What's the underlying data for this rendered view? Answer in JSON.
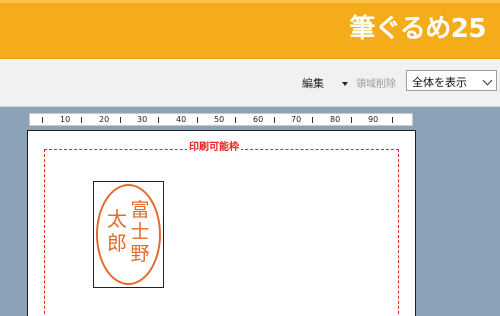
{
  "app": {
    "logo_text": "筆ぐるめ25"
  },
  "toolbar": {
    "edit_label": "編集",
    "delete_label": "領域削除",
    "view_select": {
      "value": "全体を表示"
    }
  },
  "ruler": {
    "labels": [
      "10",
      "20",
      "30",
      "40",
      "50",
      "60",
      "70",
      "80",
      "90"
    ]
  },
  "canvas": {
    "printable_label": "印刷可能枠"
  },
  "stamp": {
    "column_1": "富士野",
    "column_2": "太郎",
    "ink_color": "#e26a2c"
  },
  "colors": {
    "header": "#f5ac1b",
    "workspace": "#8ca2b6",
    "printable_border": "#e8231f"
  }
}
